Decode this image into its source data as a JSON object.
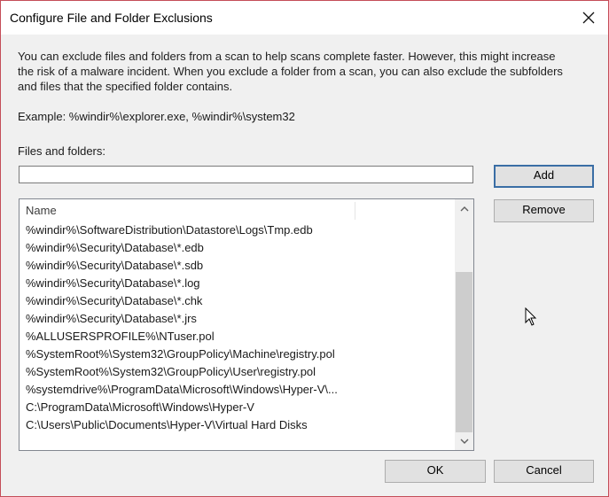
{
  "window": {
    "title": "Configure File and Folder Exclusions",
    "close_icon": "close-icon"
  },
  "description": "You can exclude files and folders from a scan to help scans complete faster. However, this might increase the risk of a malware incident. When you exclude a folder from a scan, you can also exclude the subfolders and files that the specified folder contains.",
  "example": "Example: %windir%\\explorer.exe, %windir%\\system32",
  "files_label": "Files and folders:",
  "path_input": {
    "value": "",
    "placeholder": ""
  },
  "buttons": {
    "add": "Add",
    "remove": "Remove",
    "ok": "OK",
    "cancel": "Cancel"
  },
  "list": {
    "header": "Name",
    "items": [
      "%windir%\\SoftwareDistribution\\Datastore\\Logs\\Tmp.edb",
      "%windir%\\Security\\Database\\*.edb",
      "%windir%\\Security\\Database\\*.sdb",
      "%windir%\\Security\\Database\\*.log",
      "%windir%\\Security\\Database\\*.chk",
      "%windir%\\Security\\Database\\*.jrs",
      "%ALLUSERSPROFILE%\\NTuser.pol",
      "%SystemRoot%\\System32\\GroupPolicy\\Machine\\registry.pol",
      "%SystemRoot%\\System32\\GroupPolicy\\User\\registry.pol",
      "%systemdrive%\\ProgramData\\Microsoft\\Windows\\Hyper-V\\...",
      "C:\\ProgramData\\Microsoft\\Windows\\Hyper-V",
      "C:\\Users\\Public\\Documents\\Hyper-V\\Virtual Hard Disks"
    ]
  },
  "colors": {
    "window_border": "#c44d58",
    "default_button_border": "#3a6ea5",
    "dialog_bg": "#f0f0f0"
  }
}
